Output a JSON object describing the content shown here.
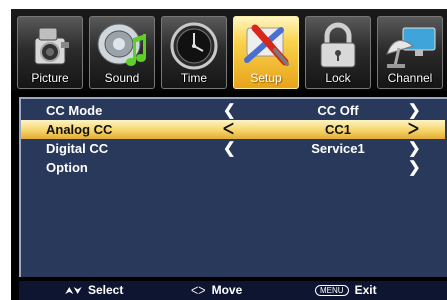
{
  "tabs": [
    {
      "label": "Picture",
      "icon": "camera-icon"
    },
    {
      "label": "Sound",
      "icon": "speaker-music-icon"
    },
    {
      "label": "Time",
      "icon": "clock-icon"
    },
    {
      "label": "Setup",
      "icon": "tools-icon",
      "active": true
    },
    {
      "label": "Lock",
      "icon": "padlock-icon"
    },
    {
      "label": "Channel",
      "icon": "satellite-dish-icon"
    }
  ],
  "menu": {
    "rows": [
      {
        "label": "CC Mode",
        "value": "CC Off",
        "left_arrow": "❮",
        "right_arrow": "❯"
      },
      {
        "label": "Analog CC",
        "value": "CC1",
        "left_arrow": "ᐸ",
        "right_arrow": "ᐳ",
        "selected": true
      },
      {
        "label": "Digital CC",
        "value": "Service1",
        "left_arrow": "❮",
        "right_arrow": "❯"
      },
      {
        "label": "Option",
        "value": "",
        "left_arrow": "",
        "right_arrow": "❯"
      }
    ]
  },
  "help": {
    "select_keys": "⮝⮟",
    "select_label": "Select",
    "move_keys": "ᐸᐳ",
    "move_label": "Move",
    "menu_key": "MENU",
    "exit_label": "Exit"
  },
  "colors": {
    "panel": "#28395c",
    "highlight": "#f6d56a",
    "active_tab": "#f9d34b"
  }
}
